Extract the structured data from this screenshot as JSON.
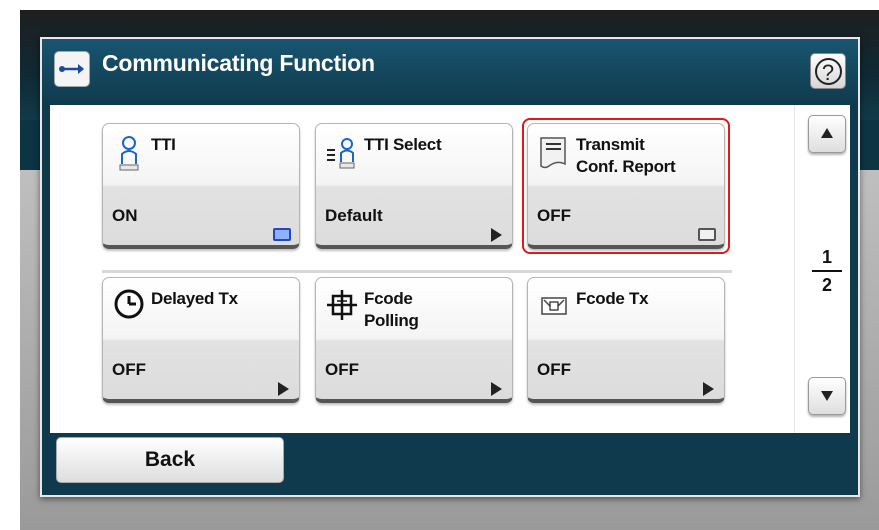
{
  "header": {
    "title": "Communicating Function",
    "title_icon": "fax-line-icon",
    "help_label": "?"
  },
  "tiles": [
    {
      "label": "TTI",
      "value": "ON",
      "icon": "person-id-icon",
      "indicator": "blue-toggle"
    },
    {
      "label": "TTI Select",
      "value": "Default",
      "icon": "list-person-icon",
      "indicator": "arrow"
    },
    {
      "label_line1": "Transmit",
      "label_line2": "Conf. Report",
      "value": "OFF",
      "icon": "report-paper-icon",
      "indicator": "grey-toggle",
      "selected": true
    },
    {
      "label": "Delayed Tx",
      "value": "OFF",
      "icon": "clock-icon",
      "indicator": "arrow"
    },
    {
      "label_line1": "Fcode",
      "label_line2": "Polling",
      "value": "OFF",
      "icon": "fcode-polling-icon",
      "indicator": "arrow"
    },
    {
      "label": "Fcode Tx",
      "value": "OFF",
      "icon": "fcode-mailbox-icon",
      "indicator": "arrow"
    }
  ],
  "pager": {
    "current": "1",
    "total": "2"
  },
  "footer": {
    "back_label": "Back"
  },
  "colors": {
    "panel": "#0f3a4d",
    "selected_border": "#e01919",
    "indicator_on": "#2245c9"
  }
}
